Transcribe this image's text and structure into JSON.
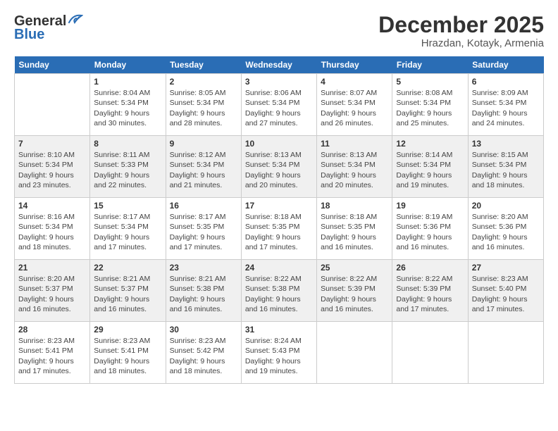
{
  "header": {
    "logo_line1": "General",
    "logo_line2": "Blue",
    "month": "December 2025",
    "location": "Hrazdan, Kotayk, Armenia"
  },
  "weekdays": [
    "Sunday",
    "Monday",
    "Tuesday",
    "Wednesday",
    "Thursday",
    "Friday",
    "Saturday"
  ],
  "weeks": [
    [
      {
        "day": "",
        "info": ""
      },
      {
        "day": "1",
        "info": "Sunrise: 8:04 AM\nSunset: 5:34 PM\nDaylight: 9 hours\nand 30 minutes."
      },
      {
        "day": "2",
        "info": "Sunrise: 8:05 AM\nSunset: 5:34 PM\nDaylight: 9 hours\nand 28 minutes."
      },
      {
        "day": "3",
        "info": "Sunrise: 8:06 AM\nSunset: 5:34 PM\nDaylight: 9 hours\nand 27 minutes."
      },
      {
        "day": "4",
        "info": "Sunrise: 8:07 AM\nSunset: 5:34 PM\nDaylight: 9 hours\nand 26 minutes."
      },
      {
        "day": "5",
        "info": "Sunrise: 8:08 AM\nSunset: 5:34 PM\nDaylight: 9 hours\nand 25 minutes."
      },
      {
        "day": "6",
        "info": "Sunrise: 8:09 AM\nSunset: 5:34 PM\nDaylight: 9 hours\nand 24 minutes."
      }
    ],
    [
      {
        "day": "7",
        "info": "Sunrise: 8:10 AM\nSunset: 5:34 PM\nDaylight: 9 hours\nand 23 minutes."
      },
      {
        "day": "8",
        "info": "Sunrise: 8:11 AM\nSunset: 5:33 PM\nDaylight: 9 hours\nand 22 minutes."
      },
      {
        "day": "9",
        "info": "Sunrise: 8:12 AM\nSunset: 5:34 PM\nDaylight: 9 hours\nand 21 minutes."
      },
      {
        "day": "10",
        "info": "Sunrise: 8:13 AM\nSunset: 5:34 PM\nDaylight: 9 hours\nand 20 minutes."
      },
      {
        "day": "11",
        "info": "Sunrise: 8:13 AM\nSunset: 5:34 PM\nDaylight: 9 hours\nand 20 minutes."
      },
      {
        "day": "12",
        "info": "Sunrise: 8:14 AM\nSunset: 5:34 PM\nDaylight: 9 hours\nand 19 minutes."
      },
      {
        "day": "13",
        "info": "Sunrise: 8:15 AM\nSunset: 5:34 PM\nDaylight: 9 hours\nand 18 minutes."
      }
    ],
    [
      {
        "day": "14",
        "info": "Sunrise: 8:16 AM\nSunset: 5:34 PM\nDaylight: 9 hours\nand 18 minutes."
      },
      {
        "day": "15",
        "info": "Sunrise: 8:17 AM\nSunset: 5:34 PM\nDaylight: 9 hours\nand 17 minutes."
      },
      {
        "day": "16",
        "info": "Sunrise: 8:17 AM\nSunset: 5:35 PM\nDaylight: 9 hours\nand 17 minutes."
      },
      {
        "day": "17",
        "info": "Sunrise: 8:18 AM\nSunset: 5:35 PM\nDaylight: 9 hours\nand 17 minutes."
      },
      {
        "day": "18",
        "info": "Sunrise: 8:18 AM\nSunset: 5:35 PM\nDaylight: 9 hours\nand 16 minutes."
      },
      {
        "day": "19",
        "info": "Sunrise: 8:19 AM\nSunset: 5:36 PM\nDaylight: 9 hours\nand 16 minutes."
      },
      {
        "day": "20",
        "info": "Sunrise: 8:20 AM\nSunset: 5:36 PM\nDaylight: 9 hours\nand 16 minutes."
      }
    ],
    [
      {
        "day": "21",
        "info": "Sunrise: 8:20 AM\nSunset: 5:37 PM\nDaylight: 9 hours\nand 16 minutes."
      },
      {
        "day": "22",
        "info": "Sunrise: 8:21 AM\nSunset: 5:37 PM\nDaylight: 9 hours\nand 16 minutes."
      },
      {
        "day": "23",
        "info": "Sunrise: 8:21 AM\nSunset: 5:38 PM\nDaylight: 9 hours\nand 16 minutes."
      },
      {
        "day": "24",
        "info": "Sunrise: 8:22 AM\nSunset: 5:38 PM\nDaylight: 9 hours\nand 16 minutes."
      },
      {
        "day": "25",
        "info": "Sunrise: 8:22 AM\nSunset: 5:39 PM\nDaylight: 9 hours\nand 16 minutes."
      },
      {
        "day": "26",
        "info": "Sunrise: 8:22 AM\nSunset: 5:39 PM\nDaylight: 9 hours\nand 17 minutes."
      },
      {
        "day": "27",
        "info": "Sunrise: 8:23 AM\nSunset: 5:40 PM\nDaylight: 9 hours\nand 17 minutes."
      }
    ],
    [
      {
        "day": "28",
        "info": "Sunrise: 8:23 AM\nSunset: 5:41 PM\nDaylight: 9 hours\nand 17 minutes."
      },
      {
        "day": "29",
        "info": "Sunrise: 8:23 AM\nSunset: 5:41 PM\nDaylight: 9 hours\nand 18 minutes."
      },
      {
        "day": "30",
        "info": "Sunrise: 8:23 AM\nSunset: 5:42 PM\nDaylight: 9 hours\nand 18 minutes."
      },
      {
        "day": "31",
        "info": "Sunrise: 8:24 AM\nSunset: 5:43 PM\nDaylight: 9 hours\nand 19 minutes."
      },
      {
        "day": "",
        "info": ""
      },
      {
        "day": "",
        "info": ""
      },
      {
        "day": "",
        "info": ""
      }
    ]
  ]
}
